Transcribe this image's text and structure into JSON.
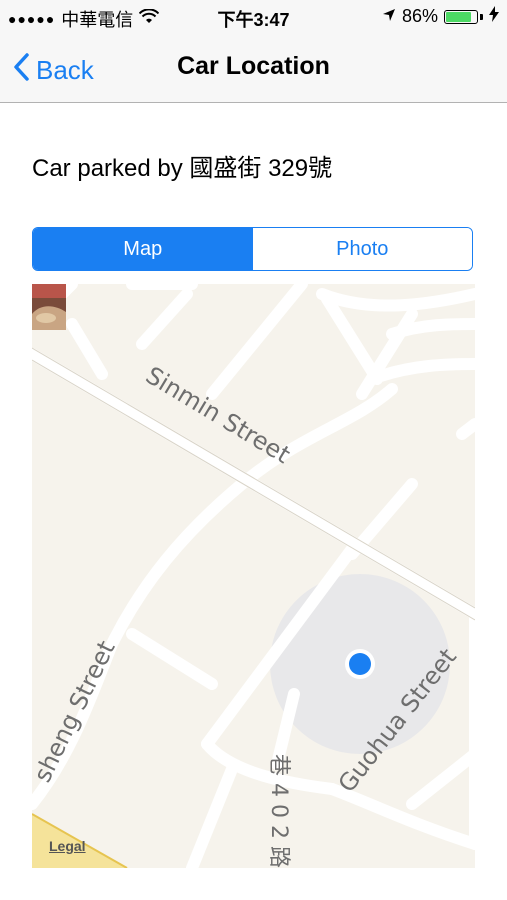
{
  "status": {
    "carrier": "中華電信",
    "time": "下午3:47",
    "battery_percent": "86%",
    "battery_level": 0.86,
    "icons": [
      "signal-dots-icon",
      "wifi-icon",
      "location-arrow-icon",
      "battery-icon",
      "charging-bolt-icon"
    ]
  },
  "nav": {
    "back_label": "Back",
    "title": "Car Location"
  },
  "headline": "Car parked by 國盛街 329號",
  "segments": [
    {
      "label": "Map",
      "active": true
    },
    {
      "label": "Photo",
      "active": false
    }
  ],
  "map": {
    "street_labels": [
      "Sinmin Street",
      "sheng Street",
      "Guohua Street",
      "巷 4 0 2 路"
    ],
    "legal": "Legal",
    "accent": "#1a7ff2",
    "user_dot_color": "#1a7ff2"
  }
}
